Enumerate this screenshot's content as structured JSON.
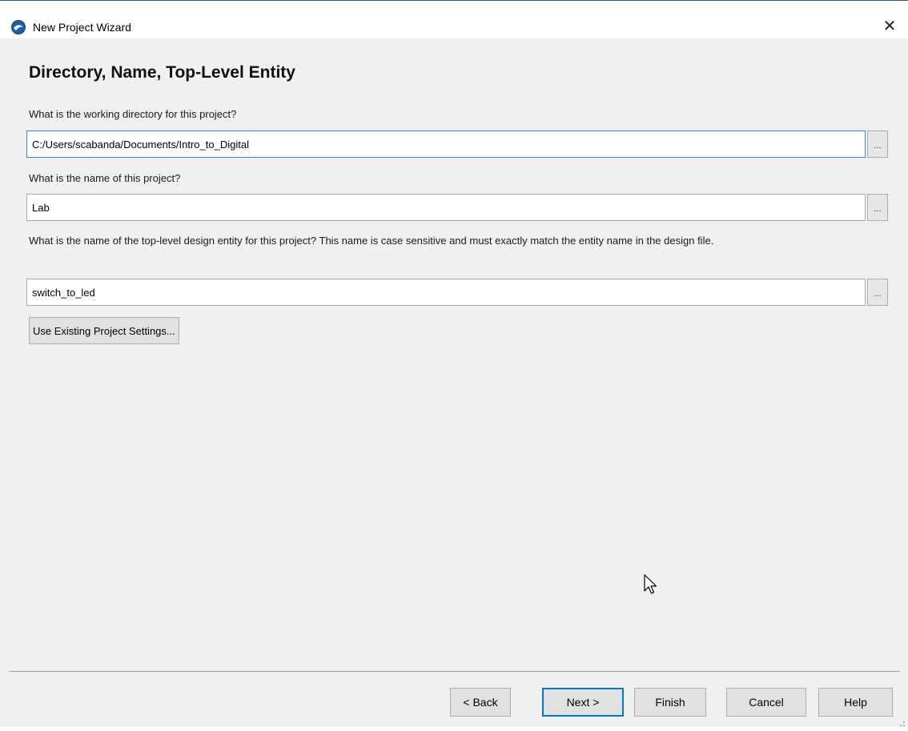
{
  "window": {
    "title": "New Project Wizard",
    "close_glyph": "✕",
    "icon": "quartus-app-icon"
  },
  "page": {
    "heading": "Directory, Name, Top-Level Entity"
  },
  "fields": {
    "working_directory": {
      "label": "What is the working directory for this project?",
      "value": "C:/Users/scabanda/Documents/Intro_to_Digital",
      "browse_label": "..."
    },
    "project_name": {
      "label": "What is the name of this project?",
      "value": "Lab",
      "browse_label": "..."
    },
    "top_level_entity": {
      "label": "What is the name of the top-level design entity for this project? This name is case sensitive and must exactly match the entity name in the design file.",
      "value": "switch_to_led",
      "browse_label": "..."
    }
  },
  "actions": {
    "use_existing": "Use Existing Project Settings..."
  },
  "footer": {
    "back": "< Back",
    "next": "Next >",
    "finish": "Finish",
    "cancel": "Cancel",
    "help": "Help"
  },
  "colors": {
    "focus_border": "#3c84d8",
    "default_button_border": "#0078d7",
    "background": "#f0f0f0"
  }
}
